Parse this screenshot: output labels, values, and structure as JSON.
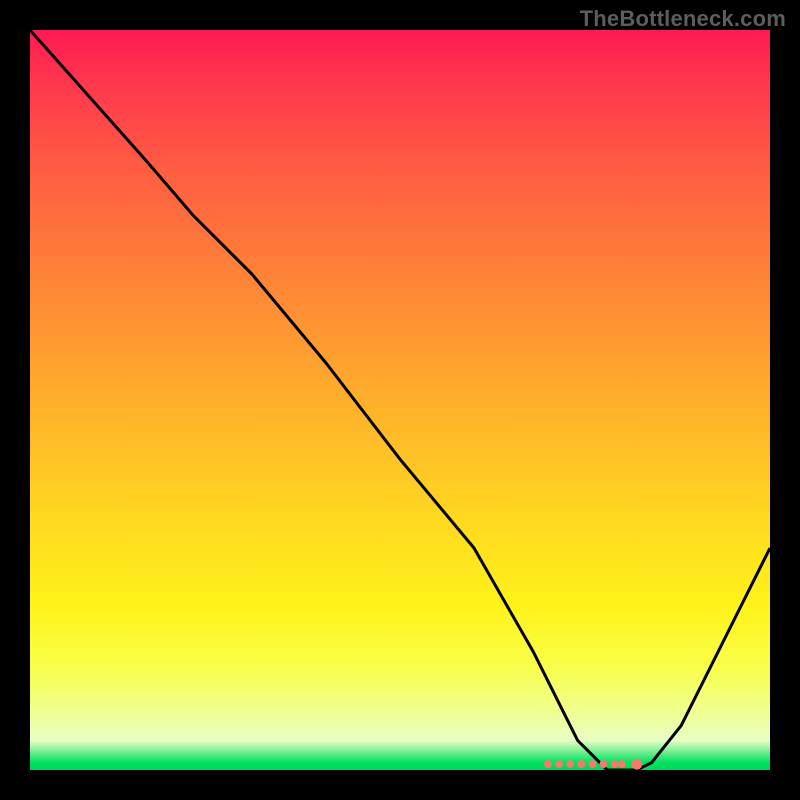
{
  "attribution": "TheBottleneck.com",
  "chart_data": {
    "type": "line",
    "title": "",
    "xlabel": "",
    "ylabel": "",
    "xlim": [
      0,
      100
    ],
    "ylim": [
      0,
      100
    ],
    "series": [
      {
        "name": "bottleneck-curve",
        "x": [
          0,
          16,
          22,
          30,
          40,
          50,
          60,
          68,
          72,
          74,
          76,
          78,
          80,
          82,
          84,
          88,
          92,
          96,
          100
        ],
        "values": [
          100,
          82,
          75,
          67,
          55,
          42,
          30,
          16,
          8,
          4,
          2,
          0,
          0,
          0,
          1,
          6,
          14,
          22,
          30
        ]
      }
    ],
    "markers": {
      "name": "optimal-range-dots",
      "x": [
        70,
        71.5,
        73,
        74.5,
        76,
        77.5,
        79,
        80,
        82
      ],
      "values": [
        0.8,
        0.8,
        0.8,
        0.8,
        0.8,
        0.8,
        0.8,
        0.8,
        0.8
      ]
    },
    "colors": {
      "curve": "#000000",
      "markers": "#f47a6a",
      "gradient_top": "#ff1a52",
      "gradient_mid": "#ffd820",
      "gradient_bottom": "#00d858"
    }
  }
}
